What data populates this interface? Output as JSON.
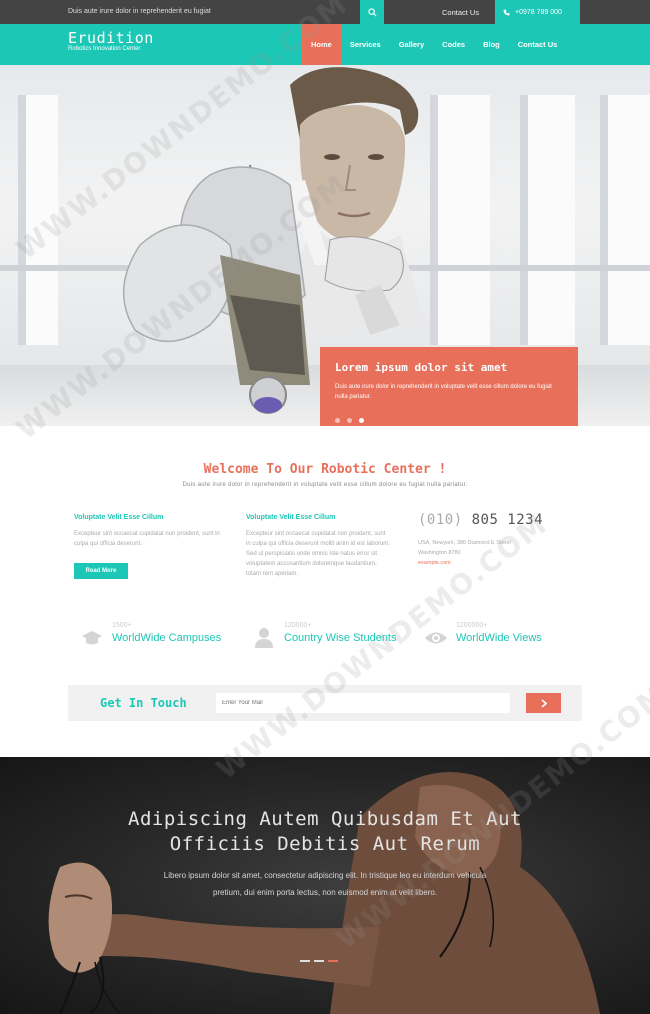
{
  "topbar": {
    "tagline": "Duis aute irure dolor in reprehenderit eu fugiat",
    "contact_link": "Contact Us",
    "phone": "+0978 789 000"
  },
  "header": {
    "logo_name": "Erudition",
    "logo_sub": "Robotics Innovation Center",
    "nav": [
      "Home",
      "Services",
      "Gallery",
      "Codes",
      "Blog",
      "Contact Us"
    ],
    "active_nav": "Home"
  },
  "hero": {
    "caption_title": "Lorem ipsum dolor sit amet",
    "caption_text": "Duis aute irure dolor in reprehenderit in voluptate velit esse cillum dolore eu fugiat nulla pariatur.",
    "slides": 3,
    "active_slide": 3
  },
  "welcome": {
    "title": "Welcome To Our Robotic Center !",
    "subtitle": "Duis aute irure dolor in reprehenderit in voluptate velit esse cillum dolore eu fugiat nulla pariatur.",
    "col1_title": "Voluptate Velit Esse Cillum",
    "col1_text": "Excepteur sint occaecat cupidatat non proident, sunt in culpa qui officia deserunt.",
    "read_more": "Read More",
    "col2_title": "Voluptate Velit Esse Cillum",
    "col2_text": "Excepteur sint occaecat cupidatat non proident, sunt in culpa qui officia deserunt mollit anim id est laborum. Sed ut perspiciatis unde omnis iste natus error sit voluptatem accusantium doloremque laudantium, totam rem aperiam.",
    "phone_code": "(010)",
    "phone_number": "805 1234",
    "address_line1": "USA, Newyork, 386 Diamond E Street",
    "address_line2": "Washington 8780",
    "email": "example.com"
  },
  "stats": [
    {
      "num": "1500+",
      "label": "WorldWide Campuses",
      "icon": "graduation-cap-icon"
    },
    {
      "num": "120000+",
      "label": "Country Wise Students",
      "icon": "user-icon"
    },
    {
      "num": "1200000+",
      "label": "WorldWide Views",
      "icon": "eye-icon"
    }
  ],
  "touch": {
    "title": "Get In Touch",
    "placeholder": "Enter Your Mail"
  },
  "dark": {
    "title_line1": "Adipiscing Autem Quibusdam Et Aut",
    "title_line2": "Officiis Debitis Aut Rerum",
    "text": "Libero ipsum dolor sit amet, consectetur adipiscing elit. In tristique leo eu interdum vehicula pretium, dui enim porta lectus, non euismod enim at velit libero."
  },
  "watermark": "WWW.DOWNDEMO.COM",
  "colors": {
    "teal": "#1cc7b5",
    "coral": "#e8705a",
    "dark_bar": "#444444"
  }
}
